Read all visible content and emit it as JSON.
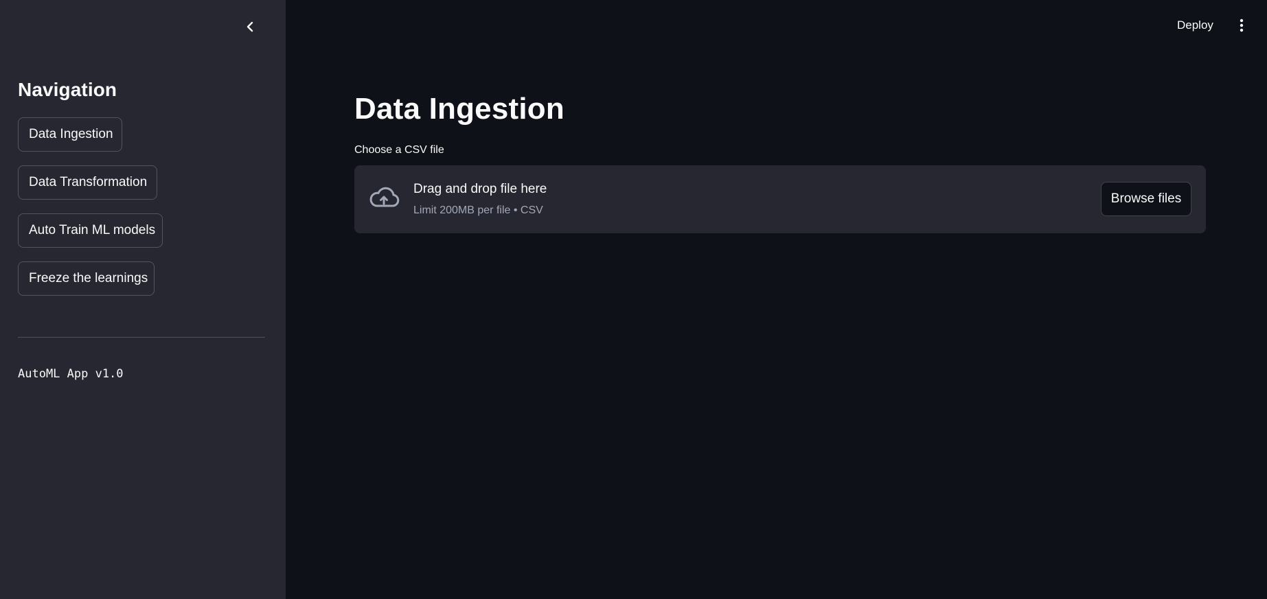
{
  "sidebar": {
    "title": "Navigation",
    "items": [
      {
        "label": "Data Ingestion"
      },
      {
        "label": "Data Transformation"
      },
      {
        "label": "Auto Train ML models"
      },
      {
        "label": "Freeze the learnings"
      }
    ],
    "footer_text": "AutoML App v1.0",
    "collapse_icon": "chevron-left-icon"
  },
  "header": {
    "deploy_label": "Deploy",
    "menu_icon": "more-vertical-icon"
  },
  "main": {
    "title": "Data Ingestion",
    "uploader": {
      "label": "Choose a CSV file",
      "drop_text": "Drag and drop file here",
      "limit_text": "Limit 200MB per file • CSV",
      "browse_label": "Browse files",
      "icon": "cloud-upload-icon"
    }
  },
  "colors": {
    "app_background": "#0e1117",
    "sidebar_background": "#262730",
    "text_primary": "#fafafa",
    "text_secondary": "#a3a8b8"
  }
}
